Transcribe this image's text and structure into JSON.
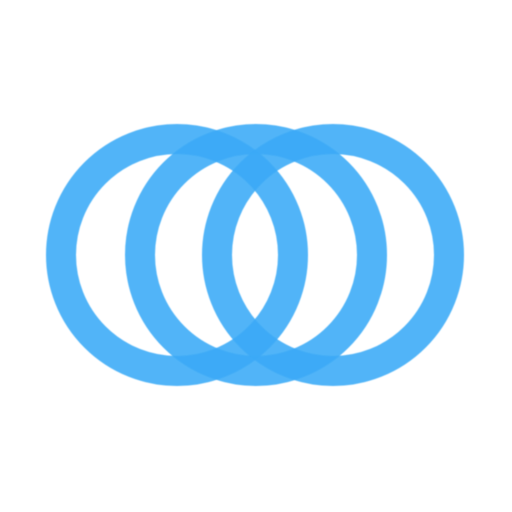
{
  "logo": {
    "icon": "three-interlocking-rings-icon",
    "ring_color": "#3aaaf7",
    "ring_opacity": 0.88,
    "background_color": "#ffffff",
    "ring_count": 3
  }
}
